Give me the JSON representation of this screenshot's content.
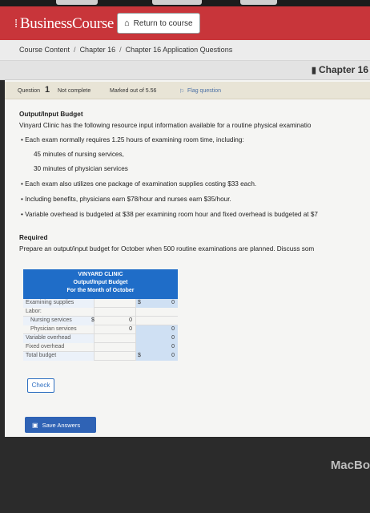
{
  "brand": {
    "name": "BusinessCourse"
  },
  "header": {
    "return_label": "Return to course"
  },
  "breadcrumb": {
    "items": [
      "Course Content",
      "Chapter 16",
      "Chapter 16 Application Questions"
    ],
    "separator": "/"
  },
  "chapter": {
    "label": "Chapter 16"
  },
  "question": {
    "prefix": "Question",
    "number": "1",
    "status": "Not complete",
    "marked": "Marked out of 5.56",
    "flag": "Flag question"
  },
  "problem": {
    "title": "Output/Input Budget",
    "intro": "Vinyard Clinic has the following resource input information available for a routine physical examinatio",
    "bullet1": "• Each exam normally requires 1.25 hours of examining room time, including:",
    "sub1": "45 minutes of nursing services,",
    "sub2": "30 minutes of physician services",
    "bullet2": "• Each exam also utilizes one package of examination supplies costing $33 each.",
    "bullet3": "• Including benefits, physicians earn $78/hour and nurses earn $35/hour.",
    "bullet4": "• Variable overhead is budgeted at $38 per examining room hour and fixed overhead is budgeted at $7",
    "required_heading": "Required",
    "required_text": "Prepare an output/input budget for October when 500 routine examinations are planned. Discuss som"
  },
  "budget": {
    "title1": "VINYARD CLINIC",
    "title2": "Output/Input Budget",
    "title3": "For the Month of October",
    "rows": {
      "supplies": {
        "label": "Examining supplies",
        "dollar": "$",
        "value": "0"
      },
      "labor": {
        "label": "Labor:"
      },
      "nursing": {
        "label": "Nursing services",
        "dollar": "$",
        "value": "0"
      },
      "physician": {
        "label": "Physician services",
        "value": "0",
        "total": "0"
      },
      "variable": {
        "label": "Variable overhead",
        "value": "0"
      },
      "fixed": {
        "label": "Fixed overhead",
        "value": "0"
      },
      "total": {
        "label": "Total budget",
        "dollar": "$",
        "value": "0"
      }
    }
  },
  "buttons": {
    "check": "Check",
    "save": "Save Answers"
  },
  "device": {
    "label": "MacBo"
  },
  "colors": {
    "brand_red": "#c8353a",
    "accent_blue": "#1f6dc8",
    "table_blue": "#cfe0f3"
  }
}
